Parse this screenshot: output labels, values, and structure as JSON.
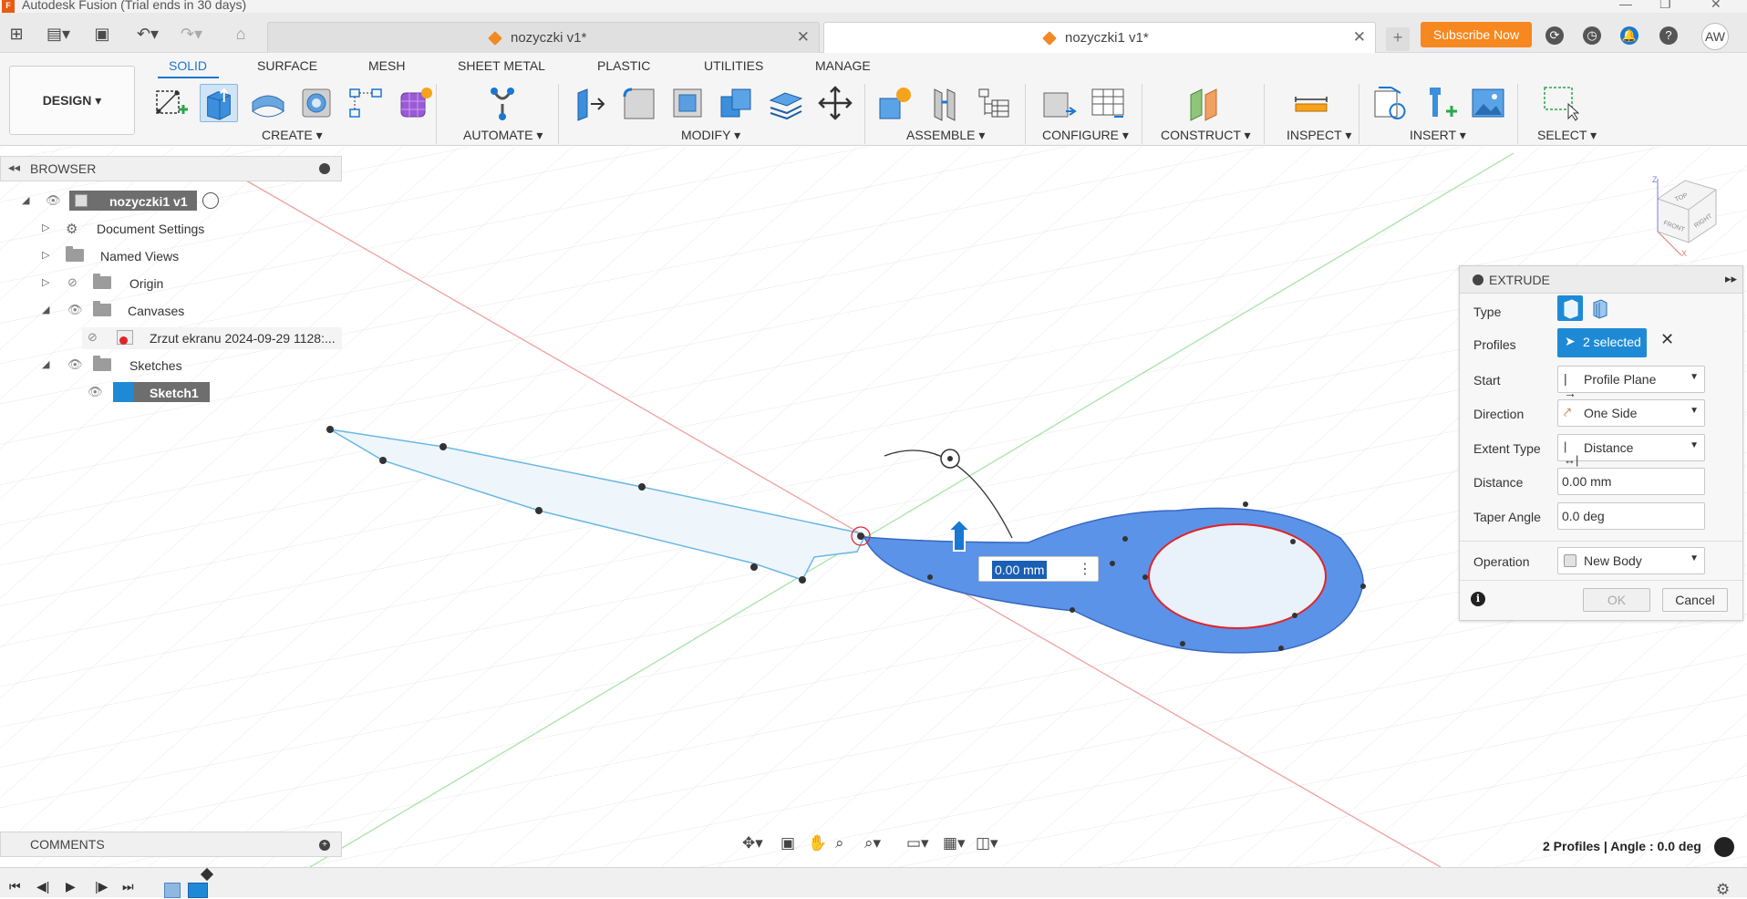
{
  "app": {
    "title": "Autodesk Fusion (Trial ends in 30 days)"
  },
  "tabs": [
    {
      "label": "nozyczki v1*",
      "active": false
    },
    {
      "label": "nozyczki1 v1*",
      "active": true
    }
  ],
  "topbar": {
    "subscribe_label": "Subscribe Now",
    "avatar_initials": "AW"
  },
  "ribbon": {
    "workspace": "DESIGN",
    "tabs": [
      "SOLID",
      "SURFACE",
      "MESH",
      "SHEET METAL",
      "PLASTIC",
      "UTILITIES",
      "MANAGE"
    ],
    "active_tab": "SOLID",
    "groups": [
      "CREATE",
      "AUTOMATE",
      "MODIFY",
      "ASSEMBLE",
      "CONFIGURE",
      "CONSTRUCT",
      "INSPECT",
      "INSERT",
      "SELECT"
    ]
  },
  "browser": {
    "title": "BROWSER",
    "items": [
      {
        "label": "nozyczki1 v1"
      },
      {
        "label": "Document Settings"
      },
      {
        "label": "Named Views"
      },
      {
        "label": "Origin"
      },
      {
        "label": "Canvases"
      },
      {
        "label": "Zrzut ekranu 2024-09-29 1128:..."
      },
      {
        "label": "Sketches"
      },
      {
        "label": "Sketch1"
      }
    ]
  },
  "extrude": {
    "title": "EXTRUDE",
    "type_label": "Type",
    "profiles_label": "Profiles",
    "profiles_value": "2 selected",
    "start_label": "Start",
    "start_value": "Profile Plane",
    "direction_label": "Direction",
    "direction_value": "One Side",
    "extent_label": "Extent Type",
    "extent_value": "Distance",
    "distance_label": "Distance",
    "distance_value": "0.00 mm",
    "taper_label": "Taper Angle",
    "taper_value": "0.0 deg",
    "operation_label": "Operation",
    "operation_value": "New Body",
    "ok_label": "OK",
    "cancel_label": "Cancel"
  },
  "canvas": {
    "distance_input": "0.00 mm"
  },
  "comments": {
    "title": "COMMENTS"
  },
  "status": {
    "text": "2 Profiles | Angle : 0.0 deg"
  },
  "colors": {
    "accent": "#1a77d2",
    "subscribe": "#f7871f",
    "profile_fill": "#5b93e8",
    "x_axis": "#e85c5c",
    "y_axis": "#6cd46c"
  }
}
